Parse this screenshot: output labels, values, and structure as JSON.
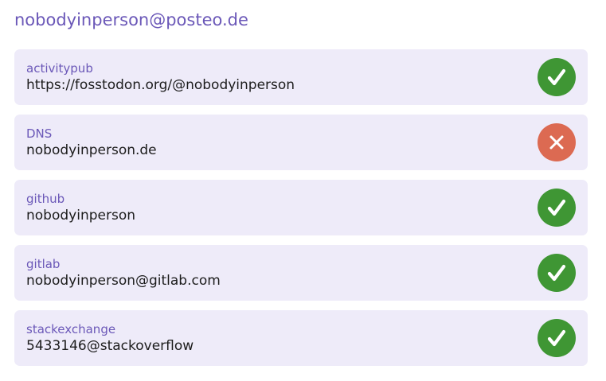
{
  "header": {
    "email": "nobodyinperson@posteo.de"
  },
  "colors": {
    "accent": "#6b58b8",
    "card_background": "#eeebf9",
    "verified": "#3f9634",
    "failed": "#dc6a52"
  },
  "claims": [
    {
      "type": "activitypub",
      "value": "https://fosstodon.org/@nobodyinperson",
      "status": "verified",
      "icon": "checkmark-icon"
    },
    {
      "type": "DNS",
      "value": "nobodyinperson.de",
      "status": "failed",
      "icon": "cross-icon"
    },
    {
      "type": "github",
      "value": "nobodyinperson",
      "status": "verified",
      "icon": "checkmark-icon"
    },
    {
      "type": "gitlab",
      "value": "nobodyinperson@gitlab.com",
      "status": "verified",
      "icon": "checkmark-icon"
    },
    {
      "type": "stackexchange",
      "value": "5433146@stackoverflow",
      "status": "verified",
      "icon": "checkmark-icon"
    }
  ]
}
